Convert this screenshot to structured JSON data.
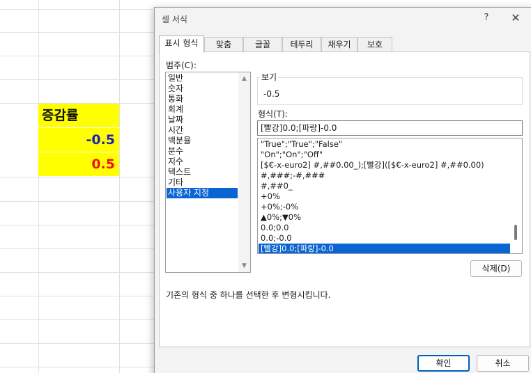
{
  "sheet": {
    "header_cell": "증감률",
    "value_1": "-0.5",
    "value_2": "0.5",
    "value_1_color": "#1f1fbf",
    "value_2_color": "#ee1111",
    "highlight_color": "#ffff00"
  },
  "dialog": {
    "title": "셀 서식",
    "help_label": "?",
    "close_label": "✕",
    "tabs": [
      "표시 형식",
      "맞춤",
      "글꼴",
      "테두리",
      "채우기",
      "보호"
    ],
    "active_tab": "표시 형식",
    "category_label": "범주(C):",
    "categories": [
      "일반",
      "숫자",
      "통화",
      "회계",
      "날짜",
      "시간",
      "백분율",
      "분수",
      "지수",
      "텍스트",
      "기타",
      "사용자 지정"
    ],
    "selected_category": "사용자 지정",
    "sample_label": "보기",
    "sample_value": "-0.5",
    "format_label": "형식(T):",
    "format_input": "[빨강]0.0;[파랑]-0.0",
    "format_list": [
      "\"True\";\"True\";\"False\"",
      "\"On\";\"On\";\"Off\"",
      "[$€-x-euro2] #,##0.00_);[빨강]([$€-x-euro2] #,##0.00)",
      "#,###;-#,###",
      "#,##0_",
      "+0%",
      "+0%;-0%",
      "▲0%;▼0%",
      "0.0;0.0",
      "0.0;-0.0",
      "[빨강]0.0;[파랑]-0.0"
    ],
    "selected_format": "[빨강]0.0;[파랑]-0.0",
    "delete_button": "삭제(D)",
    "description": "기존의 형식 중 하나를 선택한 후 변형시킵니다.",
    "ok_button": "확인",
    "cancel_button": "취소",
    "accent_color": "#0a64d2"
  },
  "icons": {
    "scroll_up": "triangle-up-icon",
    "scroll_down": "triangle-down-icon"
  }
}
